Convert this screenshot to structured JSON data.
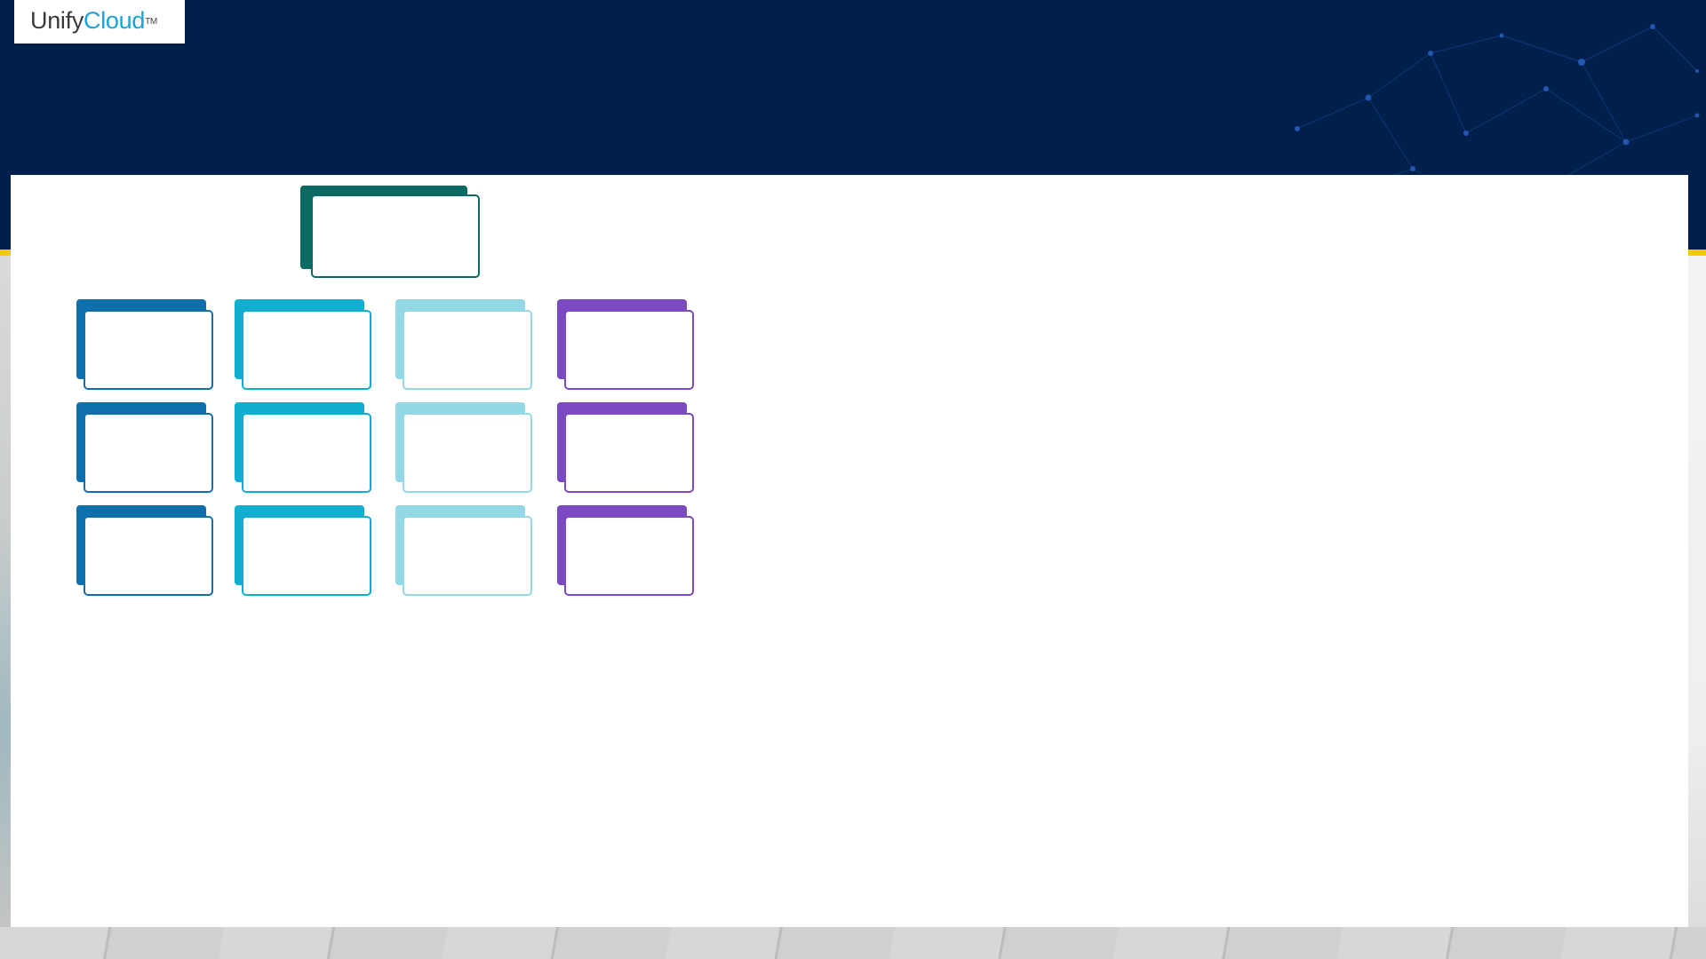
{
  "logo": {
    "part1": "Unify",
    "part2": "Cloud",
    "tm": "TM"
  },
  "colors": {
    "header_background": "#001f4a",
    "accent_stripe": "#f2c811",
    "root_card": "#0b6b63",
    "column_1": "#0f6fad",
    "column_2": "#12aed0",
    "column_3": "#94d7e6",
    "column_4": "#7b4ac3"
  },
  "diagram": {
    "root": {
      "color_key": "root_card"
    },
    "columns": [
      {
        "color_key": "column_1",
        "cards": 3
      },
      {
        "color_key": "column_2",
        "cards": 3
      },
      {
        "color_key": "column_3",
        "cards": 3
      },
      {
        "color_key": "column_4",
        "cards": 3
      }
    ]
  }
}
